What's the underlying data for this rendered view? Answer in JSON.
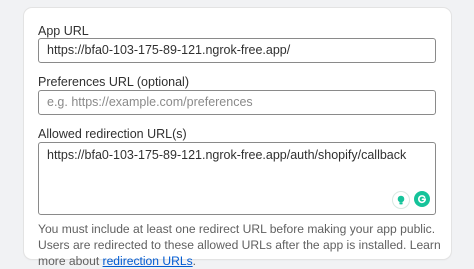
{
  "app_url": {
    "label": "App URL",
    "value": "https://bfa0-103-175-89-121.ngrok-free.app/"
  },
  "preferences_url": {
    "label": "Preferences URL (optional)",
    "placeholder": "e.g. https://example.com/preferences"
  },
  "redirection_urls": {
    "label": "Allowed redirection URL(s)",
    "value": "https://bfa0-103-175-89-121.ngrok-free.app/auth/shopify/callback"
  },
  "help": {
    "text": "You must include at least one redirect URL before making your app public. Users are redirected to these allowed URLs after the app is installed. Learn more about ",
    "link_label": "redirection URLs",
    "suffix": "."
  },
  "extension_icons": [
    "lightbulb-icon",
    "grammarly-icon"
  ],
  "colors": {
    "link": "#005bd3",
    "grammarly": "#15c39a"
  }
}
